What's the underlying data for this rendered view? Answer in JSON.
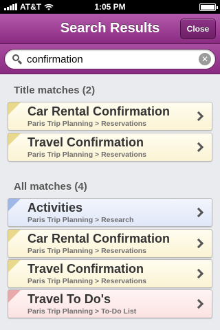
{
  "status_bar": {
    "carrier": "AT&T",
    "time": "1:05 PM",
    "signal_icon": "signal-bars-icon",
    "wifi_icon": "wifi-icon",
    "battery_icon": "battery-icon",
    "battery_level": 1.0
  },
  "nav": {
    "title": "Search Results",
    "close_label": "Close"
  },
  "search": {
    "value": "confirmation",
    "icon": "search-icon",
    "clear_icon": "clear-icon"
  },
  "sections": {
    "title_matches": {
      "header": "Title matches (2)",
      "items": [
        {
          "title": "Car Rental Confirmation",
          "path": "Paris Trip Planning > Reservations",
          "color": "#e9d98d"
        },
        {
          "title": "Travel Confirmation",
          "path": "Paris Trip Planning > Reservations",
          "color": "#e9d98d"
        }
      ]
    },
    "all_matches": {
      "header": "All matches (4)",
      "items": [
        {
          "title": "Activities",
          "path": "Paris Trip Planning > Research",
          "color": "#9fb8e6"
        },
        {
          "title": "Car Rental Confirmation",
          "path": "Paris Trip Planning > Reservations",
          "color": "#e9d98d"
        },
        {
          "title": "Travel Confirmation",
          "path": "Paris Trip Planning > Reservations",
          "color": "#e9d98d"
        },
        {
          "title": "Travel To Do's",
          "path": "Paris Trip Planning > To-Do List",
          "color": "#e7a9a9"
        }
      ]
    }
  },
  "colors": {
    "nav_top": "#b45aab",
    "nav_bottom": "#8a2b82",
    "background": "#e9ebee"
  }
}
